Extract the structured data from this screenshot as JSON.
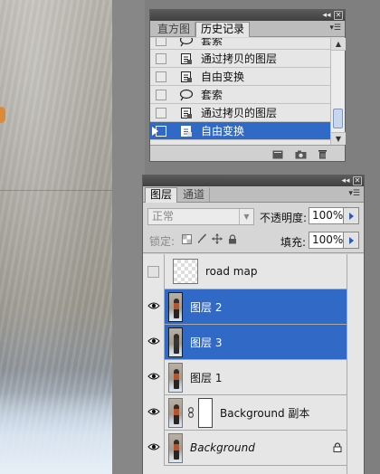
{
  "history_panel": {
    "tabs": [
      {
        "label": "直方图",
        "active": false
      },
      {
        "label": "历史记录",
        "active": true
      }
    ],
    "items": [
      {
        "label": "套索",
        "icon": "lasso-icon",
        "selected": false
      },
      {
        "label": "通过拷贝的图层",
        "icon": "history-step-icon",
        "selected": false
      },
      {
        "label": "自由变换",
        "icon": "history-step-icon",
        "selected": false
      },
      {
        "label": "套索",
        "icon": "lasso-icon",
        "selected": false
      },
      {
        "label": "通过拷贝的图层",
        "icon": "history-step-icon",
        "selected": false
      },
      {
        "label": "自由变换",
        "icon": "history-step-icon",
        "selected": true
      }
    ],
    "footer_icons": [
      "new-document-from-state-icon",
      "new-snapshot-icon",
      "delete-state-icon"
    ]
  },
  "layers_panel": {
    "tabs": [
      {
        "label": "图层",
        "active": true
      },
      {
        "label": "通道",
        "active": false
      }
    ],
    "blend_mode": "正常",
    "opacity_label": "不透明度:",
    "opacity_value": "100%",
    "lock_label": "锁定:",
    "fill_label": "填充:",
    "fill_value": "100%",
    "layers": [
      {
        "name": "road map",
        "visible": false,
        "selected": false,
        "thumb": "checker"
      },
      {
        "name": "图层 2",
        "visible": true,
        "selected": true,
        "thumb": "figure"
      },
      {
        "name": "图层 3",
        "visible": true,
        "selected": true,
        "thumb": "figure-dark"
      },
      {
        "name": "图层 1",
        "visible": true,
        "selected": false,
        "thumb": "figure"
      },
      {
        "name": "Background 副本",
        "visible": true,
        "selected": false,
        "thumb": "figure",
        "has_mask": true
      },
      {
        "name": "Background",
        "visible": true,
        "selected": false,
        "thumb": "figure",
        "locked": true,
        "italic": true
      }
    ]
  },
  "colors": {
    "selection": "#3169c6",
    "panel": "#d6d6d6",
    "list_bg": "#e6e6e6",
    "titlebar": "#4a4a4a"
  }
}
